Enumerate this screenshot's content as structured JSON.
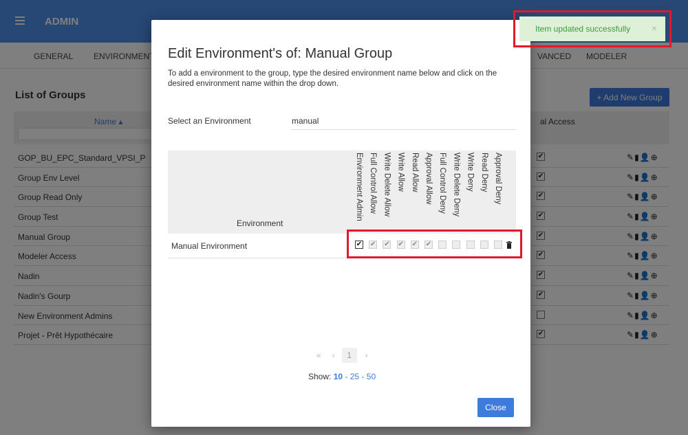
{
  "app": {
    "title": "ADMIN"
  },
  "nav": {
    "items": [
      "GENERAL",
      "ENVIRONMENTS",
      "VANCED",
      "MODELER"
    ]
  },
  "groups": {
    "title": "List of Groups",
    "add_button": "+ Add New Group",
    "columns": {
      "name": "Name ▴",
      "access": "al Access"
    },
    "rows": [
      {
        "name": "GOP_BU_EPC_Standard_VPSI_P",
        "checked": true
      },
      {
        "name": "Group Env Level",
        "checked": true
      },
      {
        "name": "Group Read Only",
        "checked": true
      },
      {
        "name": "Group Test",
        "checked": true
      },
      {
        "name": "Manual Group",
        "checked": true
      },
      {
        "name": "Modeler Access",
        "checked": true
      },
      {
        "name": "Nadin",
        "checked": true
      },
      {
        "name": "Nadin's Gourp",
        "checked": true
      },
      {
        "name": "New Environment Admins",
        "checked": false
      },
      {
        "name": "Projet - Prêt Hypothécaire",
        "checked": true
      }
    ],
    "action_icons": [
      "pencil-icon",
      "trash-icon",
      "user-icon",
      "globe-icon"
    ]
  },
  "modal": {
    "title": "Edit Environment's of: Manual Group",
    "description": "To add a environment to the group, type the desired environment name below and click on the desired environment name within the drop down.",
    "select_label": "Select an Environment",
    "select_value": "manual",
    "table_header": "Environment",
    "permissions": [
      "Environment Admin",
      "Full Control Allow",
      "Write Delete Allow",
      "Write Allow",
      "Read Allow",
      "Approval Allow",
      "Full Control Deny",
      "Write Delete Deny",
      "Write Deny",
      "Read Deny",
      "Approval Deny"
    ],
    "environment": {
      "name": "Manual Environment",
      "values": [
        true,
        true,
        true,
        true,
        true,
        true,
        false,
        false,
        false,
        false,
        false
      ]
    },
    "pager": {
      "first": "«",
      "prev": "‹",
      "page": "1",
      "next": "›"
    },
    "show": {
      "label": "Show:",
      "options": [
        "10",
        "25",
        "50"
      ],
      "current": "10",
      "separator": "-"
    },
    "close_label": "Close"
  },
  "toast": {
    "message": "Item updated successfully",
    "close": "×"
  },
  "colors": {
    "primary": "#3d7bdc",
    "topbar": "#4f8fe8",
    "highlight": "#e11a2b",
    "toast_bg": "#dff0d8",
    "toast_text": "#3c9a3c"
  }
}
